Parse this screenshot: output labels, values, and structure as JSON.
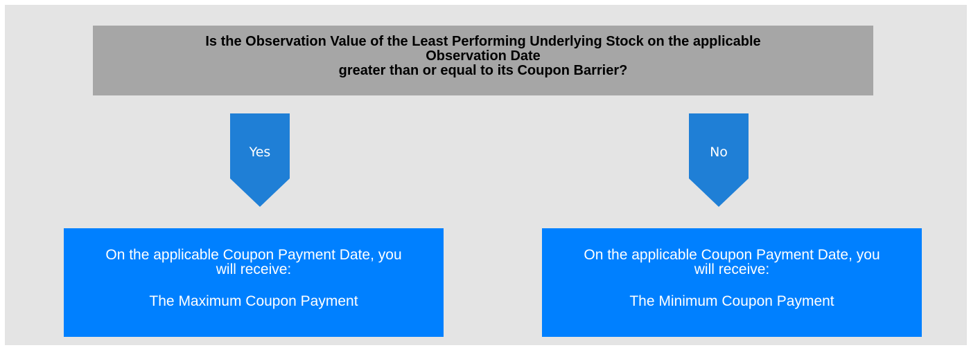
{
  "question": {
    "line1": "Is the Observation Value of the Least Performing Underlying Stock on the applicable",
    "line2": "Observation Date",
    "line3": "greater than or equal to its Coupon Barrier?"
  },
  "branches": {
    "yes_label": "Yes",
    "no_label": "No"
  },
  "outcomes": {
    "yes": {
      "line1": "On the applicable Coupon Payment Date, you",
      "line2": "will receive:",
      "payment": "The Maximum Coupon Payment"
    },
    "no": {
      "line1": "On the applicable Coupon Payment Date, you",
      "line2": "will receive:",
      "payment": "The Minimum Coupon Payment"
    }
  },
  "colors": {
    "background": "#e4e4e4",
    "question_box": "#a6a6a6",
    "arrow": "#1f7fd6",
    "result_box": "#0080ff",
    "text_light": "#ffffff",
    "text_dark": "#000000"
  }
}
